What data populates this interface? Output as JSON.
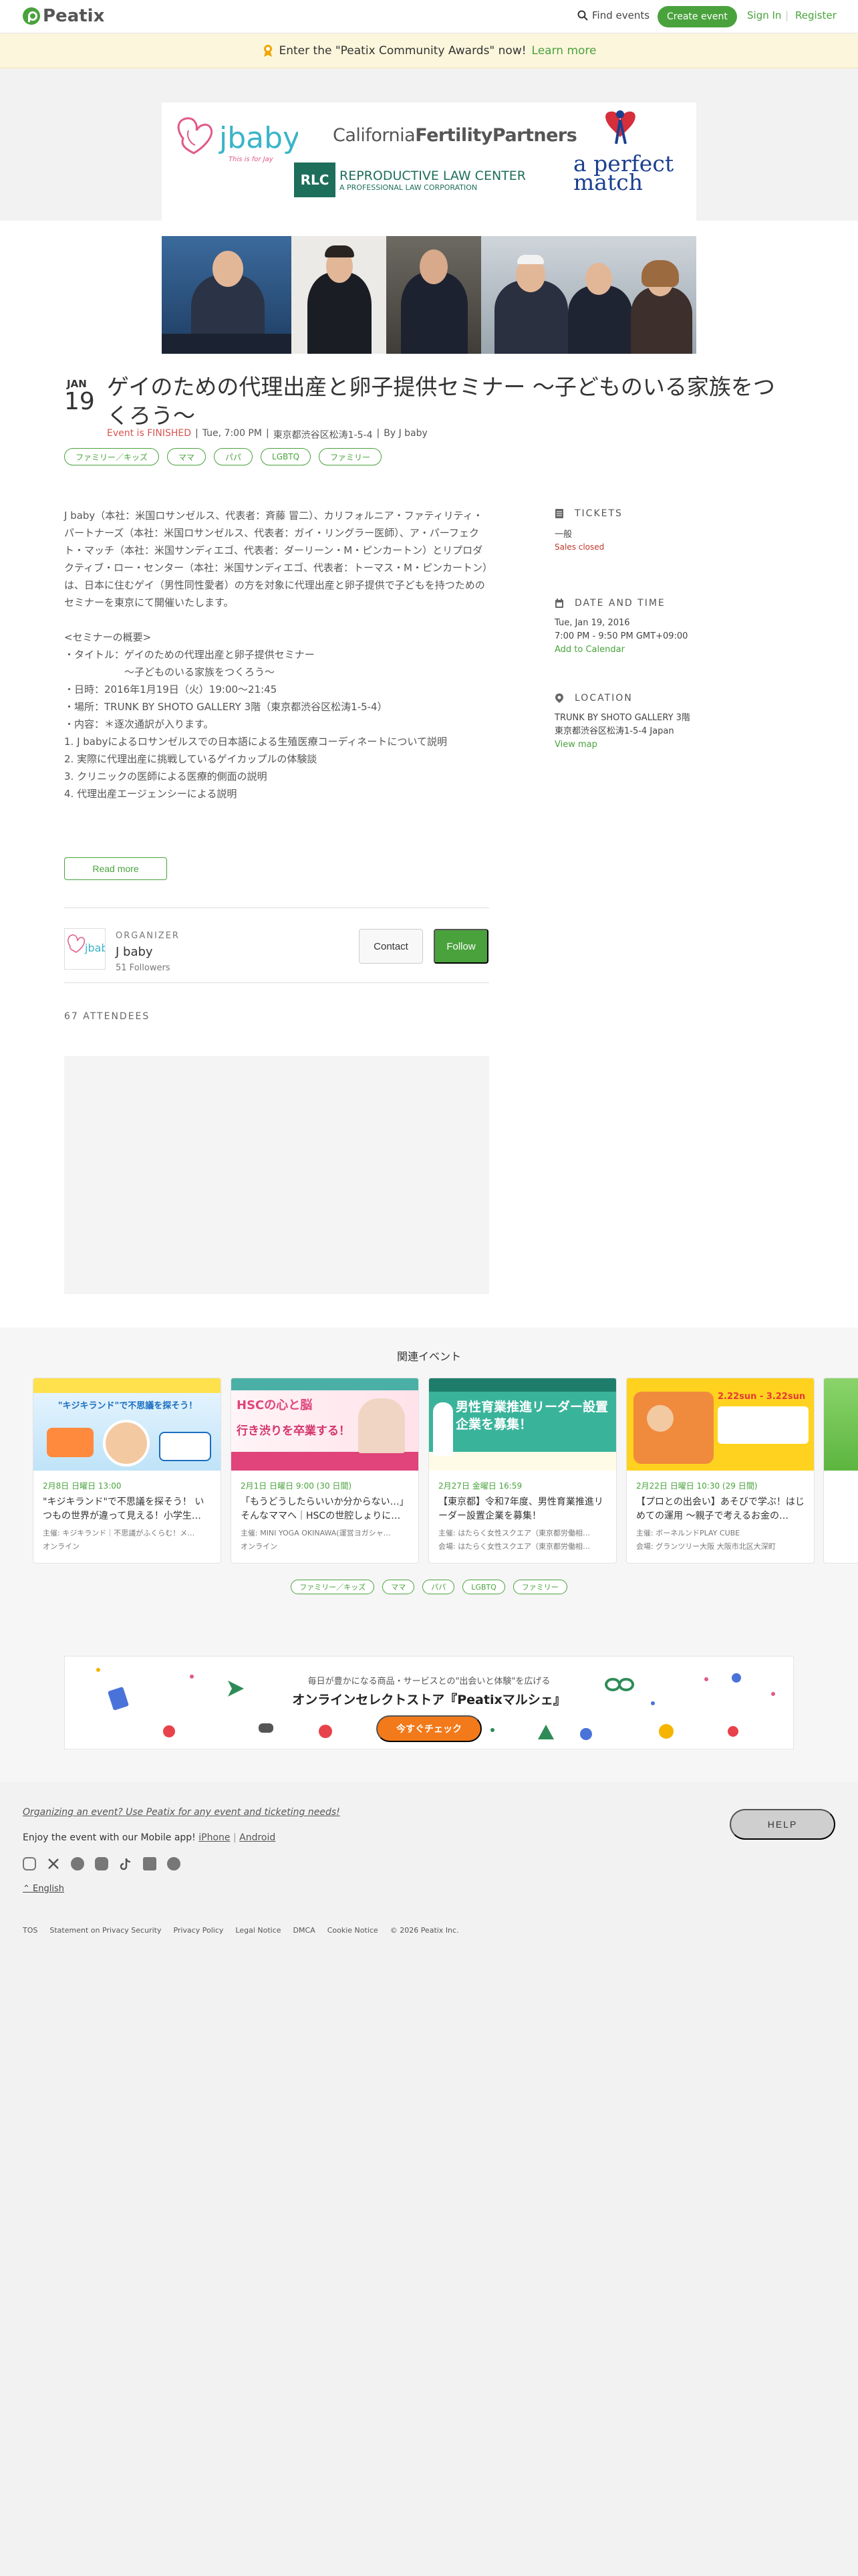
{
  "header": {
    "logo": "Peatix",
    "find_events": "Find events",
    "create_event": "Create event",
    "sign_in": "Sign In",
    "separator": "|",
    "register": "Register"
  },
  "announcement": {
    "text": "Enter the \"Peatix Community Awards\" now!",
    "link": "Learn more"
  },
  "banner": {
    "jbaby_name": "jbaby",
    "jbaby_tagline": "This is for Jay",
    "cfp_1": "California",
    "cfp_2": "FertilityPartners",
    "rlc_abbr": "RLC",
    "rlc_title": "REPRODUCTIVE LAW CENTER",
    "rlc_sub": "A PROFESSIONAL LAW CORPORATION",
    "apm": "a perfect match"
  },
  "event": {
    "month": "JAN",
    "day": "19",
    "title": "ゲイのための代理出産と卵子提供セミナー 〜子どものいる家族をつくろう〜",
    "status": "Event is FINISHED",
    "datetime": "Tue, 7:00 PM",
    "place": "東京都渋谷区松涛1-5-4",
    "by": "By J baby",
    "tags": [
      "ファミリー／キッズ",
      "ママ",
      "パパ",
      "LGBTQ",
      "ファミリー"
    ]
  },
  "description": [
    "J baby（本社：米国ロサンゼルス、代表者：斉藤 冒二）、カリフォルニア・ファティリティ・パートナーズ（本社：米国ロサンゼルス、代表者：ガイ・リングラー医師）、ア・パーフェクト・マッチ（本社：米国サンディエゴ、代表者：ダーリーン・M・ピンカートン）とリプロダクティブ・ロー・センター（本社：米国サンディエゴ、代表者：トーマス・M・ピンカートン）は、日本に住むゲイ（男性同性愛者）の方を対象に代理出産と卵子提供で子どもを持つためのセミナーを東京にて開催いたします。",
    "",
    "<セミナーの概要>",
    "・タイトル：ゲイのための代理出産と卵子提供セミナー",
    "　　　　　　〜子どものいる家族をつくろう〜",
    "・日時：2016年1月19日（火）19:00〜21:45",
    "・場所：TRUNK BY SHOTO GALLERY 3階（東京都渋谷区松涛1-5-4）",
    "・内容：＊逐次通訳が入ります。",
    "1. J babyによるロサンゼルスでの日本語による生殖医療コーディネートについて説明",
    "2. 実際に代理出産に挑戦しているゲイカップルの体験談",
    "3. クリニックの医師による医療的側面の説明",
    "4. 代理出産エージェンシーによる説明"
  ],
  "read_more": "Read more",
  "organizer": {
    "label": "ORGANIZER",
    "name": "J baby",
    "followers": "51 Followers",
    "contact": "Contact",
    "follow": "Follow"
  },
  "attendees": "67 ATTENDEES",
  "sidebar": {
    "tickets_h": "TICKETS",
    "ticket_name": "一般",
    "ticket_status": "Sales closed",
    "dt_h": "DATE AND TIME",
    "dt_1": "Tue, Jan 19, 2016",
    "dt_2": "7:00 PM - 9:50 PM GMT+09:00",
    "add_cal": "Add to Calendar",
    "loc_h": "LOCATION",
    "loc_1": "TRUNK BY SHOTO GALLERY 3階",
    "loc_2": "東京都渋谷区松涛1-5-4 Japan",
    "view_map": "View map"
  },
  "related": {
    "title": "関連イベント",
    "cards": [
      {
        "date": "2月8日 日曜日 13:00",
        "title": "\"キジキランド\"で不思議を探そう！ いつもの世界が違って見える！小学生…",
        "line1": "主催: キジキランド｜不思議がふくらむ！メ…",
        "line2": "オンライン",
        "img_text": "\"キジキランド\"で不思議を探そう！"
      },
      {
        "date": "2月1日 日曜日 9:00 (30 日間)",
        "title": "「もうどうしたらいいか分からない…」そんなママへ｜HSCの世腔しょりに…",
        "line1": "主催: MINI YOGA OKINAWA(運営ヨガシャ…",
        "line2": "オンライン",
        "img_text": "行き渋りを卒業する！"
      },
      {
        "date": "2月27日 金曜日 16:59",
        "title": "【東京都】令和7年度、男性育業推進リーダー設置企業を募集！",
        "line1": "主催: はたらく女性スクエア（東京都労働相…",
        "line2": "会場: はたらく女性スクエア（東京都労働相…",
        "img_text": "男性育業推進リーダー設置企業を募集！"
      },
      {
        "date": "2月22日 日曜日 10:30 (29 日間)",
        "title": "【プロとの出会い】あそびで学ぶ！はじめての運用 〜親子で考えるお金の…",
        "line1": "主催: ボーネルンドPLAY CUBE",
        "line2": "会場: グランツリー大阪 大阪市北区大深町",
        "img_text": "2.22sun - 3.22sun"
      }
    ],
    "tags": [
      "ファミリー／キッズ",
      "ママ",
      "パパ",
      "LGBTQ",
      "ファミリー"
    ]
  },
  "ad": {
    "line1": "毎日が豊かになる商品・サービスとの\"出会いと体験\"を広げる",
    "line2": "オンラインセレクトストア『Peatixマルシェ』",
    "button": "今すぐチェック"
  },
  "footer": {
    "organizing": "Organizing an event? Use Peatix for any event and ticketing needs!",
    "app_text": "Enjoy the event with our Mobile app!",
    "iphone": "iPhone",
    "android": "Android",
    "language": "English",
    "help": "HELP",
    "links": [
      "TOS",
      "Statement on Privacy Security",
      "Privacy Policy",
      "Legal Notice",
      "DMCA",
      "Cookie Notice",
      "© 2026 Peatix Inc."
    ]
  },
  "colors": {
    "accent": "#4aa23d",
    "finished": "#d9534f",
    "announce_bg": "#fcf6dc"
  }
}
